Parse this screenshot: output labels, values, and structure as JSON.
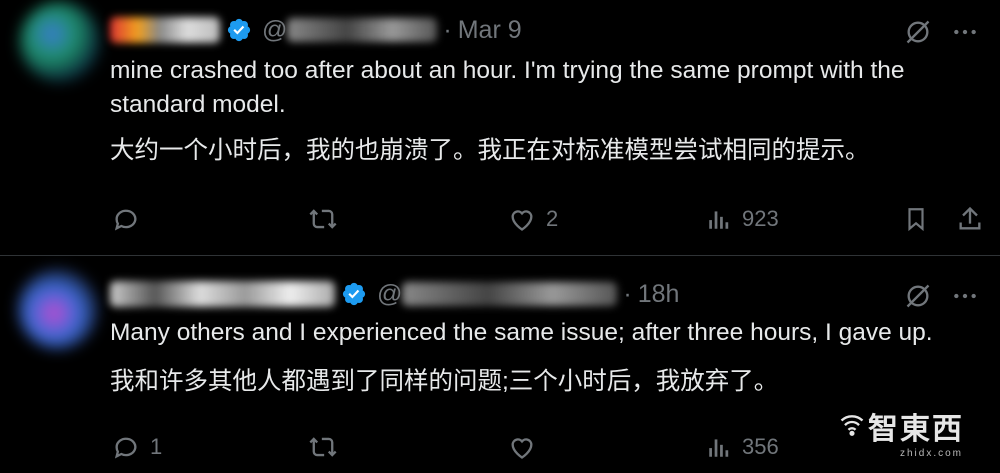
{
  "posts": [
    {
      "date": "Mar 9",
      "handle_prefix": "@",
      "text_en": "mine crashed too after about an hour. I'm trying the same prompt with the standard model.",
      "text_zh": "大约一个小时后，我的也崩溃了。我正在对标准模型尝试相同的提示。",
      "replies": "",
      "likes": "2",
      "views": "923"
    },
    {
      "date": "18h",
      "handle_prefix": "@",
      "text_en": "Many others and I experienced the same issue; after three hours, I gave up.",
      "text_zh": "我和许多其他人都遇到了同样的问题;三个小时后，我放弃了。",
      "replies": "1",
      "likes": "",
      "views": "356"
    }
  ],
  "separator": "·",
  "watermark": {
    "text": "智東西",
    "sub": "zhidx.com"
  },
  "colors": {
    "background": "#000000",
    "text": "#e7e9ea",
    "muted": "#71767b",
    "verified": "#1d9bf0",
    "divider": "#2f3336"
  },
  "icons": [
    "verified-badge-icon",
    "grok-icon",
    "more-icon",
    "reply-icon",
    "repost-icon",
    "like-icon",
    "views-icon",
    "bookmark-icon",
    "share-icon"
  ]
}
